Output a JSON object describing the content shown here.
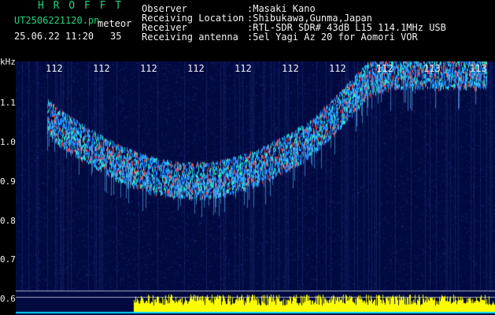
{
  "header": {
    "app_title": "H R O F F T",
    "file_name": "UT2506221120.pn",
    "date_time": "25.06.22 11:20",
    "category": "meteor",
    "count": "35",
    "fields": [
      {
        "label": "Observer",
        "value": ":Masaki Kano"
      },
      {
        "label": "Receiving Location",
        "value": ":Shibukawa,Gunma,Japan"
      },
      {
        "label": "Receiver",
        "value": ":RTL-SDR SDR# 43dB L15 114.1MHz USB"
      },
      {
        "label": "Receiving antenna",
        "value": ":5el Yagi Az 20 for Aomori VOR"
      }
    ]
  },
  "spectrogram": {
    "y_unit": "kHz",
    "y_ticks": [
      "1.1",
      "1.0",
      "0.9",
      "0.8",
      "0.7",
      "0.6"
    ],
    "x_ticks": [
      "112",
      "112",
      "112",
      "112",
      "112",
      "112",
      "112",
      "112",
      "113"
    ],
    "colors": {
      "background": "#000a40",
      "signal_cool": "#1e8bff",
      "signal_mid": "#2ee6c8",
      "signal_hot": "#ff3a3a",
      "activity_bar": "#ffff00",
      "baseline": "#00d8ff"
    }
  }
}
